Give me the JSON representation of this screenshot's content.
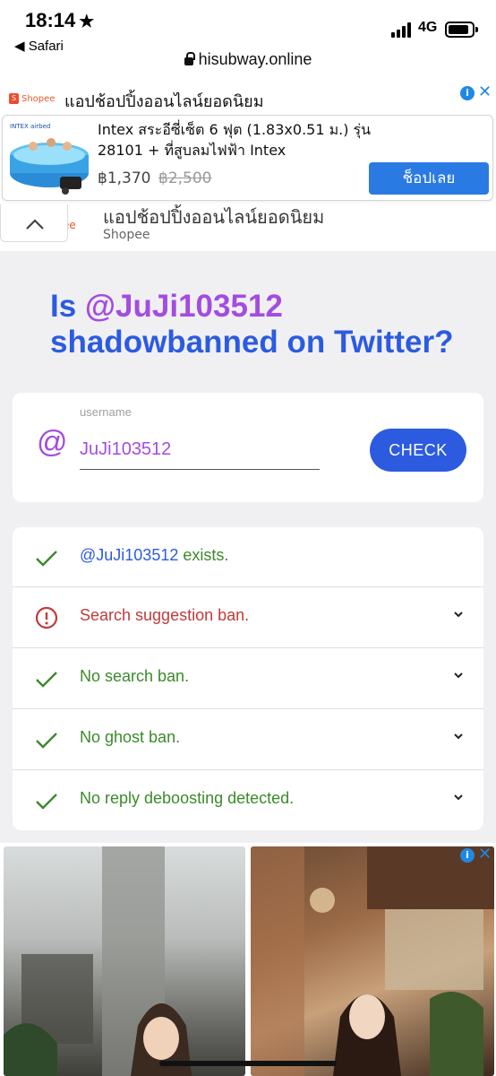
{
  "status": {
    "time": "18:14",
    "back_app": "Safari",
    "network": "4G"
  },
  "browser": {
    "url": "hisubway.online"
  },
  "ad_top": {
    "brand": "Shopee",
    "headline": "แอปช้อปปิ้งออนไลน์ยอดนิยม",
    "product_title": "Intex สระอีซี่เซ็ต 6 ฟุต (1.83x0.51 ม.) รุ่น 28101 + ที่สูบลมไฟฟ้า Intex",
    "price": "฿1,370",
    "old_price": "฿2,500",
    "cta": "ช็อปเลย",
    "ghost_headline": "แอปช้อปปิ้งออนไลน์ยอดนิยม",
    "ghost_brand": "Shopee",
    "ghost_logo": "ee",
    "info_label": "i",
    "close_label": "✕"
  },
  "heading": {
    "prefix": "Is ",
    "username": "@JuJi103512",
    "suffix": " shadowbanned on Twitter?"
  },
  "form": {
    "at_symbol": "@",
    "label": "username",
    "value": "JuJi103512",
    "button": "CHECK"
  },
  "results": [
    {
      "status": "ok",
      "user": "@JuJi103512",
      "text": " exists.",
      "expandable": false
    },
    {
      "status": "ban",
      "text": "Search suggestion ban.",
      "expandable": true
    },
    {
      "status": "ok",
      "text": "No search ban.",
      "expandable": true
    },
    {
      "status": "ok",
      "text": "No ghost ban.",
      "expandable": true
    },
    {
      "status": "ok",
      "text": "No reply deboosting detected.",
      "expandable": true
    }
  ],
  "ad_bottom": {
    "info_label": "i",
    "close_label": "✕"
  },
  "colors": {
    "primary": "#2c5be0",
    "username": "#a44ce0",
    "ok": "#3b8a2a",
    "ban": "#c23a3a"
  }
}
